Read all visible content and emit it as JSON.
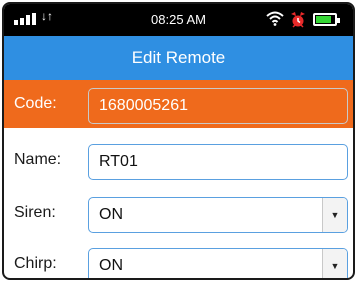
{
  "status_bar": {
    "time": "08:25 AM",
    "signal_icon": "signal-bars-icon",
    "data_icon": "data-transfer-icon",
    "wifi_icon": "wifi-icon",
    "alarm_icon": "alarm-clock-icon",
    "battery_icon": "battery-icon",
    "battery_level": 0.85,
    "battery_color": "#35d635"
  },
  "header": {
    "title": "Edit Remote",
    "color": "#2f8fe2"
  },
  "form": {
    "code": {
      "label": "Code:",
      "value": "1680005261",
      "highlight_color": "#ef6a1c"
    },
    "name": {
      "label": "Name:",
      "value": "RT01"
    },
    "siren": {
      "label": "Siren:",
      "value": "ON"
    },
    "chirp": {
      "label": "Chirp:",
      "value": "ON"
    }
  }
}
